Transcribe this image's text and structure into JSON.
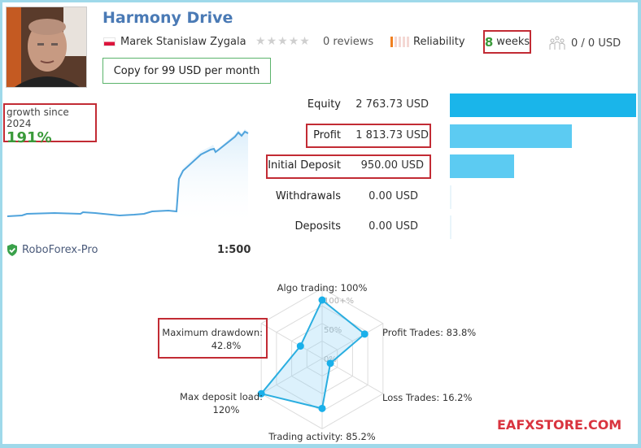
{
  "header": {
    "title": "Harmony Drive",
    "author": "Marek Stanislaw Zygala",
    "rating_stars": 0,
    "reviews": "0 reviews",
    "reliability_label": "Reliability",
    "reliability_level": 1,
    "reliability_max": 5,
    "weeks_value": "8",
    "weeks_label": "weeks",
    "subscribers": "0 / 0 USD",
    "copy_button": "Copy for 99 USD per month"
  },
  "growth": {
    "label": "growth since 2024",
    "value": "191%"
  },
  "account": {
    "broker": "RoboForex-Pro",
    "leverage": "1:500"
  },
  "financials": [
    {
      "label": "Equity",
      "value": "2 763.73 USD",
      "amount": 2763.73,
      "color": "#1ab5ea"
    },
    {
      "label": "Profit",
      "value": "1 813.73 USD",
      "amount": 1813.73,
      "color": "#5ccbf2"
    },
    {
      "label": "Initial Deposit",
      "value": "950.00 USD",
      "amount": 950.0,
      "color": "#5ccbf2"
    },
    {
      "label": "Withdrawals",
      "value": "0.00 USD",
      "amount": 0,
      "color": "#5ccbf2"
    },
    {
      "label": "Deposits",
      "value": "0.00 USD",
      "amount": 0,
      "color": "#5ccbf2"
    }
  ],
  "radar": {
    "scale_labels": [
      "100+%",
      "50%",
      "0%"
    ],
    "axes": [
      {
        "label": "Algo trading: 100%",
        "value": 100
      },
      {
        "label": "Profit Trades: 83.8%",
        "value": 83.8
      },
      {
        "label": "Loss Trades: 16.2%",
        "value": 16.2
      },
      {
        "label": "Trading activity: 85.2%",
        "value": 85.2
      },
      {
        "label": "Max deposit load:",
        "label2": "120%",
        "value": 120
      },
      {
        "label": "Maximum drawdown:",
        "label2": "42.8%",
        "value": 42.8
      }
    ]
  },
  "watermark": "EAFXSTORE.COM",
  "colors": {
    "accent": "#1ab5ea",
    "title": "#4a7ab5",
    "positive": "#3a9a3a",
    "highlight_box": "#c22b34"
  }
}
